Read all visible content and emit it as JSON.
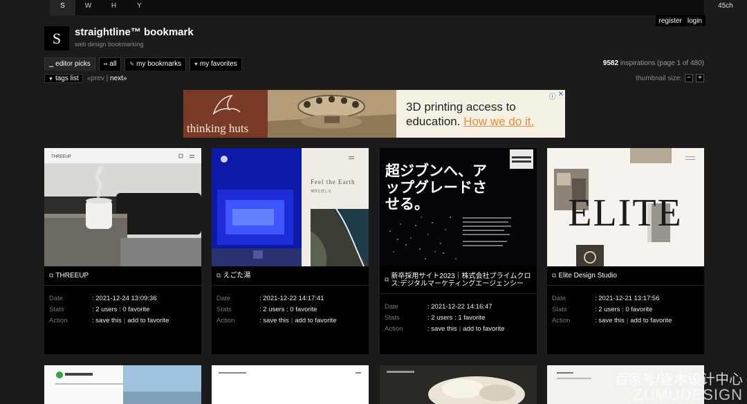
{
  "nav": {
    "letters": [
      "S",
      "W",
      "H",
      "Y"
    ],
    "channel": "45ch",
    "register": "register",
    "login": "login"
  },
  "site": {
    "logo_letter": "S",
    "title": "straightline™ bookmark",
    "subtitle": "web design bookmarking"
  },
  "tabs": [
    {
      "label": "editor picks",
      "icon": "dash-icon"
    },
    {
      "label": "all",
      "icon": "grid-icon"
    },
    {
      "label": "my bookmarks",
      "icon": "pencil-icon"
    },
    {
      "label": "my favorites",
      "icon": "heart-icon"
    }
  ],
  "stats": {
    "count": "9582",
    "label": "inspirations (page 1 of 480)"
  },
  "subbar": {
    "tags": "tags list",
    "prev": "«prev",
    "divider": "|",
    "next": "next»",
    "thumb_label": "thumbnail size:",
    "minus": "−",
    "plus": "+"
  },
  "ad": {
    "brand": "thinking huts",
    "line1": "3D printing access to",
    "line2_prefix": "education.",
    "line2_highlight": "How we do it."
  },
  "labels": {
    "date": "Date",
    "stats": "Stats",
    "action": "Action",
    "save": "save this",
    "fav": "add to favorite"
  },
  "cards": [
    {
      "title": "THREEUP",
      "date": ": 2021-12-24 13:09:36",
      "stats": ": 2 users : 0 favorite",
      "thumb_brand": "THREEUP"
    },
    {
      "title": "えごた湯",
      "date": ": 2021-12-22 14:17:41",
      "stats": ": 2 users : 0 favorite",
      "thumb_text": "Feel the Earth",
      "thumb_sub": "裸体を感じる"
    },
    {
      "title": "新卒採用サイト2023｜株式会社プライムクロス:デジタルマーケティングエージェンシー",
      "date": ": 2021-12-22 14:16:47",
      "stats": ": 2 users : 1 favorite",
      "thumb_text": "超ジブンへ、アップグレードさせる。"
    },
    {
      "title": "Elite Design Studio",
      "date": ": 2021-12-21 13:17:56",
      "stats": ": 2 users : 0 favorite",
      "thumb_text": "ELITE"
    }
  ],
  "watermark": {
    "line1": "百家号/逐木设计中心",
    "line2": "ZUMUDESIGN"
  }
}
